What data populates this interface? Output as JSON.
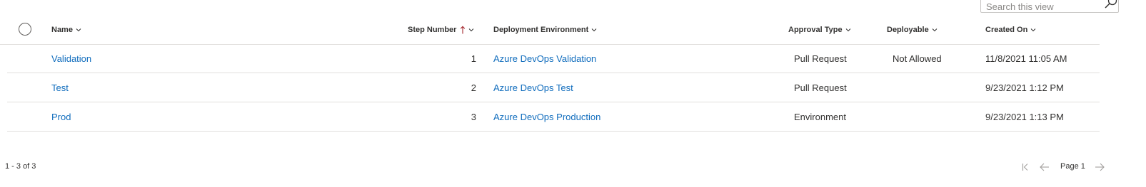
{
  "search": {
    "placeholder": "Search this view"
  },
  "columns": {
    "name": "Name",
    "step": "Step Number",
    "env": "Deployment Environment",
    "approval": "Approval Type",
    "deployable": "Deployable",
    "created": "Created On"
  },
  "rows": [
    {
      "name": "Validation",
      "step": "1",
      "env": "Azure DevOps Validation",
      "approval": "Pull Request",
      "deployable": "Not Allowed",
      "created": "11/8/2021 11:05 AM"
    },
    {
      "name": "Test",
      "step": "2",
      "env": "Azure DevOps Test",
      "approval": "Pull Request",
      "deployable": "",
      "created": "9/23/2021 1:12 PM"
    },
    {
      "name": "Prod",
      "step": "3",
      "env": "Azure DevOps Production",
      "approval": "Environment",
      "deployable": "",
      "created": "9/23/2021 1:13 PM"
    }
  ],
  "footer": {
    "count": "1 - 3 of 3",
    "page": "Page 1"
  },
  "colors": {
    "link": "#0f6cbd",
    "sort_arrow": "#a4262c",
    "border": "#e1dfdd",
    "text": "#323130"
  },
  "icons": [
    "search-icon",
    "chevron-down-icon",
    "sort-ascending-icon",
    "first-page-icon",
    "previous-page-icon",
    "next-page-icon"
  ]
}
